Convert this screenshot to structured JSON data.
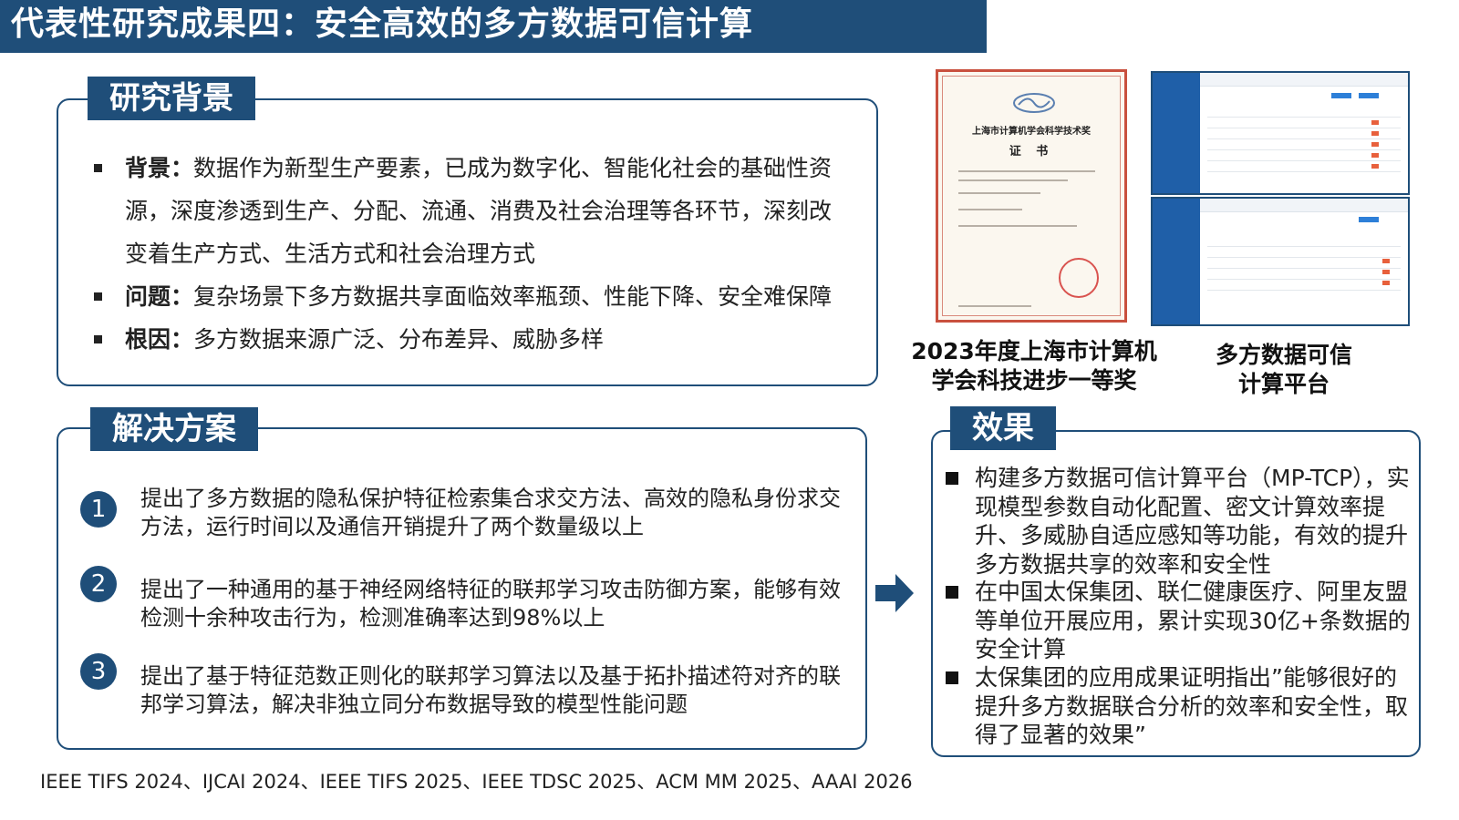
{
  "header": {
    "title": "代表性研究成果四：安全高效的多方数据可信计算"
  },
  "background": {
    "tag": "研究背景",
    "items": [
      {
        "label": "背景：",
        "line1": "数据作为新型生产要素，已成为数字化、智能化社会的基础性资",
        "line2": "源，深度渗透到生产、分配、流通、消费及社会治理等各环节，深刻改",
        "line3": "变着生产方式、生活方式和社会治理方式"
      },
      {
        "label": "问题：",
        "line1": "复杂场景下多方数据共享面临效率瓶颈、性能下降、安全难保障"
      },
      {
        "label": "根因：",
        "line1": "多方数据来源广泛、分布差异、威胁多样"
      }
    ]
  },
  "solution": {
    "tag": "解决方案",
    "items": [
      {
        "num": "1",
        "text": "提出了多方数据的隐私保护特征检索集合求交方法、高效的隐私身份求交方法，运行时间以及通信开销提升了两个数量级以上"
      },
      {
        "num": "2",
        "text": "提出了一种通用的基于神经网络特征的联邦学习攻击防御方案，能够有效检测十余种攻击行为，检测准确率达到98%以上"
      },
      {
        "num": "3",
        "text": "提出了基于特征范数正则化的联邦学习算法以及基于拓扑描述符对齐的联邦学习算法，解决非独立同分布数据导致的模型性能问题"
      }
    ]
  },
  "effect": {
    "tag": "效果",
    "items": [
      {
        "text": "构建多方数据可信计算平台（MP-TCP），实现模型参数自动化配置、密文计算效率提升、多威胁自适应感知等功能，有效的提升多方数据共享的效率和安全性"
      },
      {
        "text": "在中国太保集团、联仁健康医疗、阿里友盟等单位开展应用，累计实现30亿+条数据的安全计算"
      },
      {
        "text": "太保集团的应用成果证明指出”能够很好的提升多方数据联合分析的效率和安全性，取得了显著的效果”"
      }
    ]
  },
  "figures": {
    "certificate": {
      "title": "上海市计算机学会科学技术奖",
      "subtitle": "证 书",
      "caption_line1": "2023年度上海市计算机",
      "caption_line2": "学会科技进步一等奖"
    },
    "platform": {
      "caption_line1": "多方数据可信",
      "caption_line2": "计算平台"
    }
  },
  "references": "IEEE TIFS 2024、IJCAI 2024、IEEE TIFS 2025、IEEE TDSC 2025、ACM MM 2025、AAAI 2026",
  "colors": {
    "primary": "#1f4e79",
    "seal": "#d9534f"
  }
}
